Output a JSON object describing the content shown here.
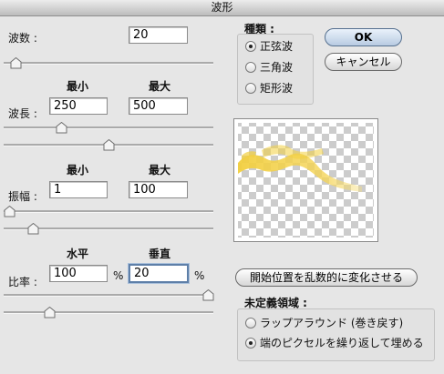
{
  "window": {
    "title": "波形"
  },
  "generators": {
    "label": "波数 :",
    "value": "20",
    "slider_level": 0.03
  },
  "wavelength": {
    "label": "波長 :",
    "min_header": "最小",
    "max_header": "最大",
    "min_value": "250",
    "max_value": "500",
    "min_slider_level": 0.26,
    "max_slider_level": 0.5
  },
  "amplitude": {
    "label": "振幅 :",
    "min_header": "最小",
    "max_header": "最大",
    "min_value": "1",
    "max_value": "100",
    "min_slider_level": 0.0,
    "max_slider_level": 0.12
  },
  "scale": {
    "label": "比率 :",
    "horizontal_header": "水平",
    "vertical_header": "垂直",
    "horizontal_value": "100",
    "vertical_value": "20",
    "unit": "%",
    "horizontal_slider_level": 1.0,
    "vertical_slider_level": 0.2
  },
  "type": {
    "label": "種類 :",
    "options": [
      "正弦波",
      "三角波",
      "矩形波"
    ],
    "selected": 0
  },
  "buttons": {
    "ok": "OK",
    "cancel": "キャンセル",
    "randomize": "開始位置を乱数的に変化させる"
  },
  "undefined_areas": {
    "label": "未定義領域 :",
    "options": [
      "ラップアラウンド (巻き戻す)",
      "端のピクセルを繰り返して埋める"
    ],
    "selected": 1
  },
  "colors": {
    "accent": "#5e7fa8",
    "wave": "#f2cf3e"
  },
  "icons": {
    "slider_thumb": "slider-thumb-icon"
  }
}
